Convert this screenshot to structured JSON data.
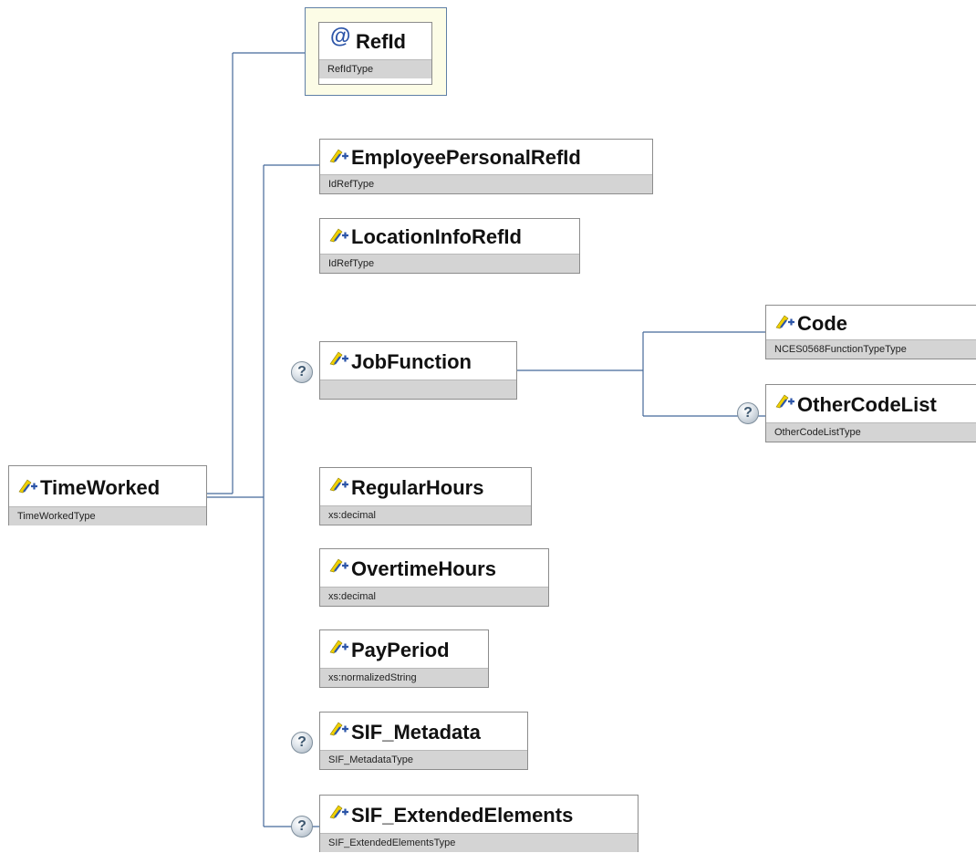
{
  "root": {
    "name": "TimeWorked",
    "type": "TimeWorkedType",
    "icon": "element-icon"
  },
  "attribute": {
    "name": "RefId",
    "type": "RefIdType",
    "icon": "attribute-at-icon",
    "symbol": "@"
  },
  "children": [
    {
      "key": "employee-personal-ref-id",
      "name": "EmployeePersonalRefId",
      "type": "IdRefType",
      "optional": false
    },
    {
      "key": "location-info-ref-id",
      "name": "LocationInfoRefId",
      "type": "IdRefType",
      "optional": false
    },
    {
      "key": "job-function",
      "name": "JobFunction",
      "type": "",
      "optional": true
    },
    {
      "key": "regular-hours",
      "name": "RegularHours",
      "type": "xs:decimal",
      "optional": false
    },
    {
      "key": "overtime-hours",
      "name": "OvertimeHours",
      "type": "xs:decimal",
      "optional": false
    },
    {
      "key": "pay-period",
      "name": "PayPeriod",
      "type": "xs:normalizedString",
      "optional": false
    },
    {
      "key": "sif-metadata",
      "name": "SIF_Metadata",
      "type": "SIF_MetadataType",
      "optional": true
    },
    {
      "key": "sif-extended-elements",
      "name": "SIF_ExtendedElements",
      "type": "SIF_ExtendedElementsType",
      "optional": true
    }
  ],
  "job_function_children": [
    {
      "key": "code",
      "name": "Code",
      "type": "NCES0568FunctionTypeType",
      "optional": false
    },
    {
      "key": "other-code-list",
      "name": "OtherCodeList",
      "type": "OtherCodeListType",
      "optional": true
    }
  ],
  "optional_marker": "?",
  "colors": {
    "connector": "#45699a",
    "attribute_background": "#fcfce6",
    "type_band": "#d4d4d4",
    "icon_yellow": "#f0d000",
    "icon_blue": "#2c55a8"
  }
}
